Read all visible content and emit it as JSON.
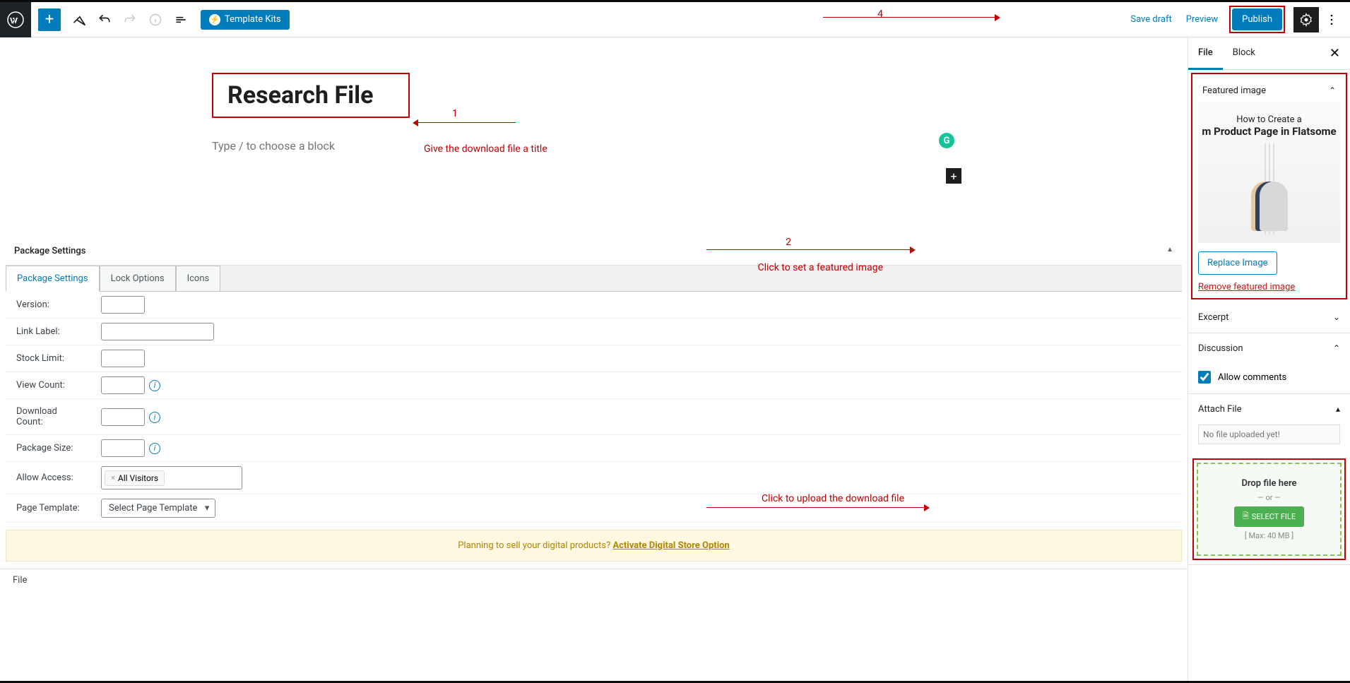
{
  "toolbar": {
    "template_kits": "Template Kits",
    "save_draft": "Save draft",
    "preview": "Preview",
    "publish": "Publish"
  },
  "editor": {
    "title": "Research File",
    "block_placeholder": "Type / to choose a block"
  },
  "annotations": {
    "a1_num": "1",
    "a1_text": "Give the download file a title",
    "a2_num": "2",
    "a2_text": "Click to set a featured image",
    "a3_text": "Click to upload the download file",
    "a4_num": "4"
  },
  "metabox": {
    "title": "Package Settings",
    "tabs": [
      "Package Settings",
      "Lock Options",
      "Icons"
    ],
    "rows": {
      "version": "Version:",
      "link_label": "Link Label:",
      "stock_limit": "Stock Limit:",
      "view_count": "View Count:",
      "download_count": "Download Count:",
      "package_size": "Package Size:",
      "allow_access": "Allow Access:",
      "page_template": "Page Template:"
    },
    "access_tag": "All Visitors",
    "page_template_select": "Select Page Template"
  },
  "notice": {
    "text": "Planning to sell your digital products? ",
    "link": "Activate Digital Store Option"
  },
  "footer": {
    "breadcrumb": "File"
  },
  "sidebar": {
    "tabs": [
      "File",
      "Block"
    ],
    "featured": {
      "title": "Featured image",
      "thumb_t1": "How to Create a",
      "thumb_t2": "m Product Page in Flatsome",
      "replace": "Replace Image",
      "remove": "Remove featured image"
    },
    "excerpt": {
      "title": "Excerpt"
    },
    "discussion": {
      "title": "Discussion",
      "allow": "Allow comments"
    },
    "attach": {
      "title": "Attach File",
      "no_file": "No file uploaded yet!",
      "drop": "Drop file here",
      "or": "— or —",
      "select": "SELECT FILE",
      "max": "[ Max: 40 MB ]"
    }
  }
}
